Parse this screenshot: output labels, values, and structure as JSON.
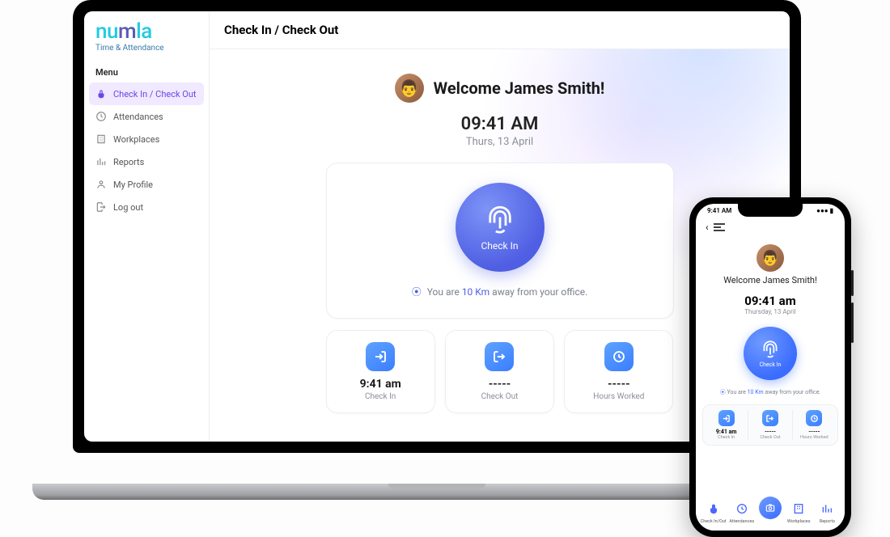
{
  "brand": {
    "name": "numla",
    "sub": "Time & Attendance"
  },
  "menu": {
    "header": "Menu",
    "items": [
      {
        "label": "Check In / Check Out",
        "icon": "tap"
      },
      {
        "label": "Attendances",
        "icon": "clock"
      },
      {
        "label": "Workplaces",
        "icon": "building"
      },
      {
        "label": "Reports",
        "icon": "chart"
      },
      {
        "label": "My Profile",
        "icon": "user"
      },
      {
        "label": "Log out",
        "icon": "logout"
      }
    ]
  },
  "page": {
    "title": "Check In / Check Out"
  },
  "welcome": {
    "text": "Welcome James Smith!"
  },
  "clock": {
    "time": "09:41 AM",
    "date": "Thurs, 13 April"
  },
  "checkin": {
    "label": "Check In"
  },
  "distance": {
    "prefix": "You are ",
    "km": "10 Km",
    "suffix": " away from your office."
  },
  "stats": [
    {
      "val": "9:41 am",
      "lbl": "Check In"
    },
    {
      "val": "-----",
      "lbl": "Check Out"
    },
    {
      "val": "-----",
      "lbl": "Hours Worked"
    }
  ],
  "phone": {
    "status_time": "9:41 AM",
    "welcome": "Welcome James Smith!",
    "time": "09:41 am",
    "date": "Thursday, 13 April",
    "checkin": "Check In",
    "dist_prefix": "You are ",
    "dist_km": "10 Km",
    "dist_suffix": " away from your office.",
    "stats": [
      {
        "val": "9:41 am",
        "lbl": "Check In"
      },
      {
        "val": "-----",
        "lbl": "Check Out"
      },
      {
        "val": "-----",
        "lbl": "Hours Worked"
      }
    ],
    "nav": [
      {
        "lbl": "Check In/Out"
      },
      {
        "lbl": "Attendances"
      },
      {
        "lbl": ""
      },
      {
        "lbl": "Workplaces"
      },
      {
        "lbl": "Reports"
      }
    ]
  }
}
